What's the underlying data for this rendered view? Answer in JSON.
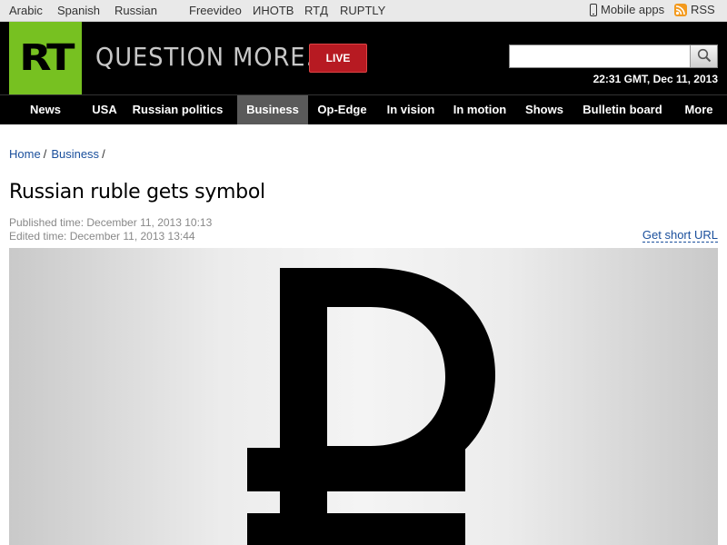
{
  "topbar": {
    "languages": [
      "Arabic",
      "Spanish",
      "Russian"
    ],
    "partners": [
      "Freevideo",
      "ИНОТВ",
      "RTД",
      "RUPTLY"
    ],
    "mobile_apps": "Mobile apps",
    "rss": "RSS"
  },
  "header": {
    "logo": "RT",
    "tagline": "QUESTION MORE.",
    "live": "LIVE",
    "search_placeholder": "",
    "clock": "22:31 GMT, Dec 11, 2013"
  },
  "nav": [
    "News",
    "USA",
    "Russian politics",
    "Business",
    "Op-Edge",
    "In vision",
    "In motion",
    "Shows",
    "Bulletin board",
    "More"
  ],
  "nav_active": "Business",
  "breadcrumb": [
    "Home",
    "Business"
  ],
  "article": {
    "title": "Russian ruble gets symbol",
    "published": "Published time: December 11, 2013 10:13",
    "edited": "Edited time: December 11, 2013 13:44",
    "short_url": "Get short URL"
  },
  "hero_image": {
    "icon": "ruble-sign-icon"
  },
  "colors": {
    "brand_green": "#77c121",
    "live_red": "#b71a22",
    "link_blue": "#1a4f9c"
  }
}
